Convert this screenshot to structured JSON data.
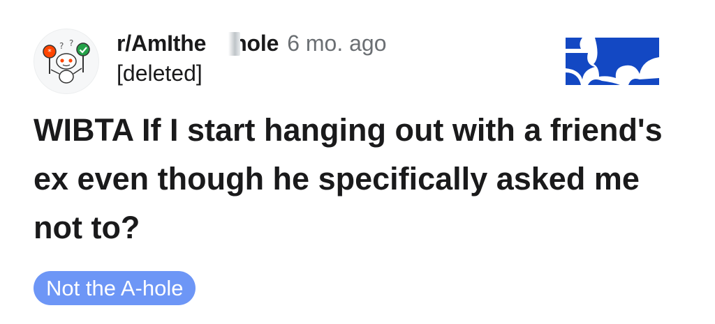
{
  "post": {
    "subreddit": "r/AmIthe",
    "subreddit_tail": "hole",
    "age": "6 mo. ago",
    "author": "[deleted]",
    "title": "WIBTA If I start hanging out with a friend's ex even though he specifically asked me not to?",
    "flair": "Not the A-hole"
  },
  "icons": {
    "avatar": "snoo-avatar-icon",
    "join": "join-button-icon"
  },
  "colors": {
    "flair_bg": "#6d96f6",
    "join_blue": "#1348c3",
    "text": "#1a1a1b",
    "meta": "#6b6f73"
  }
}
